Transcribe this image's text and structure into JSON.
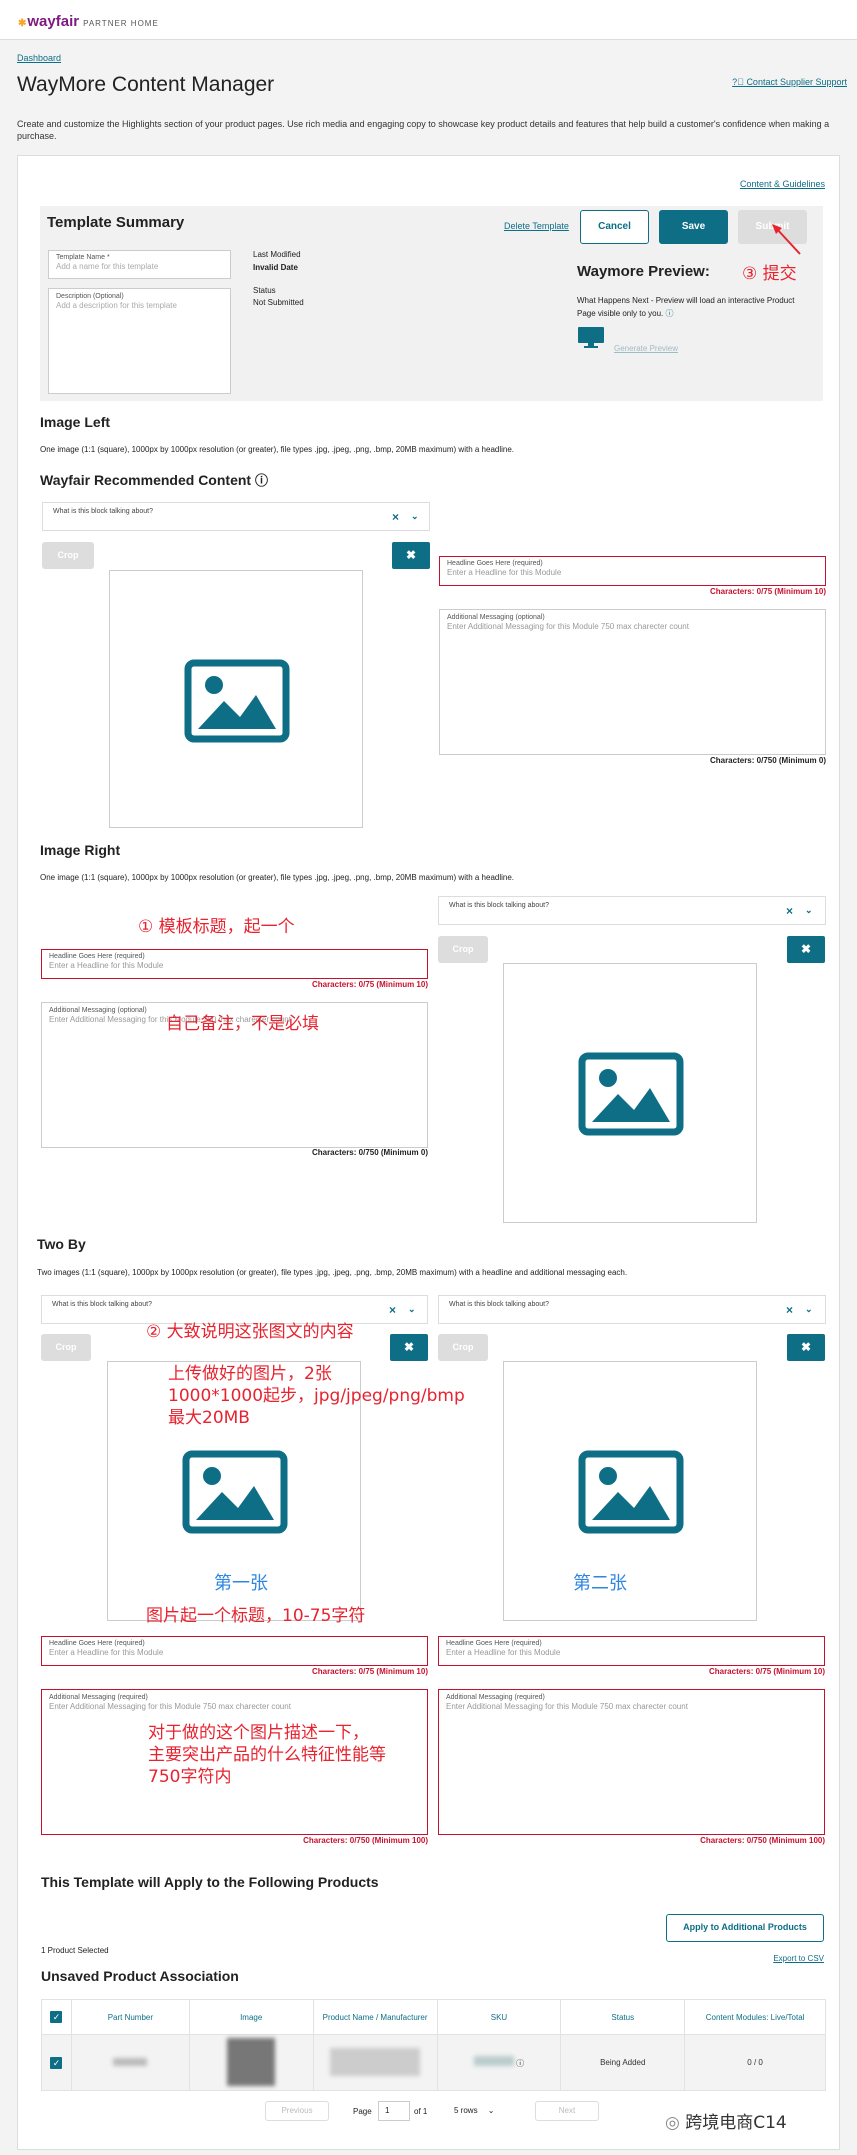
{
  "header": {
    "logo": "wayfair",
    "logo_sub": "PARTNER HOME"
  },
  "breadcrumb": "Dashboard",
  "page": {
    "title": "WayMore Content Manager",
    "contact": "Contact Supplier Support",
    "intro": "Create and customize the Highlights section of your product pages. Use rich media and engaging copy to showcase key product details and features that help build a customer's confidence when making a purchase."
  },
  "guidelines": "Content & Guidelines",
  "summary": {
    "title": "Template Summary",
    "delete": "Delete Template",
    "cancel": "Cancel",
    "save": "Save",
    "submit": "Submit",
    "name_label": "Template Name *",
    "name_ph": "Add a name for this template",
    "desc_label": "Description (Optional)",
    "desc_ph": "Add a description for this template",
    "last_modified_label": "Last Modified",
    "last_modified_value": "Invalid Date",
    "status_label": "Status",
    "status_value": "Not Submitted",
    "preview_title": "Waymore Preview:",
    "preview_text": "What Happens Next - Preview will load an interactive Product Page visible only to you.",
    "preview_link": "Generate Preview",
    "annot_submit": "③ 提交"
  },
  "common": {
    "dropdown_label": "What is this block talking about?",
    "crop": "Crop",
    "headline_label": "Headline Goes Here (required)",
    "headline_ph": "Enter a Headline for this Module",
    "headline_counter": "Characters: 0/75 (Minimum 10)",
    "msg_opt_label": "Additional Messaging (optional)",
    "msg_req_label": "Additional Messaging (required)",
    "msg_ph": "Enter Additional Messaging for this Module  750 max charecter count",
    "msg_counter_opt": "Characters: 0/750 (Minimum 0)",
    "msg_counter_req": "Characters: 0/750 (Minimum 100)"
  },
  "image_left": {
    "title": "Image Left",
    "desc": "One image (1:1 (square), 1000px by 1000px resolution (or greater), file types .jpg, .jpeg, .png, .bmp,  20MB maximum) with a headline.",
    "recommended": "Wayfair Recommended Content"
  },
  "image_right": {
    "title": "Image Right",
    "desc": "One image (1:1 (square), 1000px by 1000px resolution (or greater), file types .jpg, .jpeg, .png, .bmp,  20MB maximum) with a headline.",
    "annot_title": "① 模板标题，起一个",
    "annot_note": "自己备注，不是必填"
  },
  "two_by": {
    "title": "Two By",
    "desc": "Two images (1:1 (square), 1000px by 1000px resolution (or greater), file types .jpg, .jpeg, .png, .bmp,  20MB maximum) with a headline and additional messaging each.",
    "annot_desc": "② 大致说明这张图文的内容",
    "annot_upload1": "上传做好的图片，2张",
    "annot_upload2": "1000*1000起步，jpg/jpeg/png/bmp",
    "annot_upload3": "最大20MB",
    "annot_first": "第一张",
    "annot_second": "第二张",
    "annot_headline": "图片起一个标题，10-75字符",
    "annot_msg1": "对于做的这个图片描述一下，",
    "annot_msg2": "主要突出产品的什么特征性能等",
    "annot_msg3": "750字符内"
  },
  "products": {
    "title": "This Template will Apply to the Following Products",
    "apply_btn": "Apply to Additional Products",
    "selected": "1 Product Selected",
    "export": "Export to CSV",
    "unsaved": "Unsaved Product Association",
    "columns": [
      "Part Number",
      "Image",
      "Product Name / Manufacturer",
      "SKU",
      "Status",
      "Content Modules: Live/Total"
    ],
    "row_status": "Being Added",
    "row_modules": "0 / 0"
  },
  "pagination": {
    "previous": "Previous",
    "page_label": "Page",
    "page_value": "1",
    "of": "of 1",
    "rows": "5 rows",
    "next": "Next"
  },
  "watermark": "跨境电商C14"
}
